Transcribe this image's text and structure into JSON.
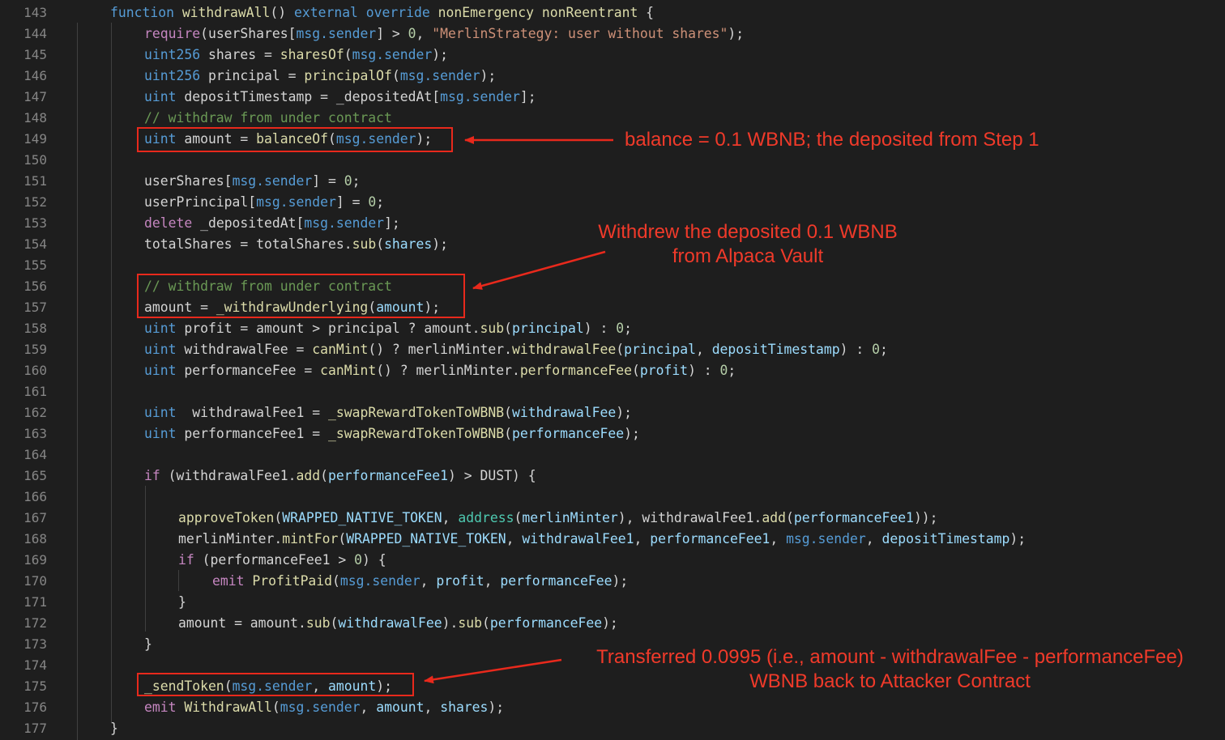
{
  "editor": {
    "lines": [
      {
        "num": "143",
        "indent": 0,
        "tokens": [
          [
            "function ",
            "kw"
          ],
          [
            "withdrawAll",
            "fn"
          ],
          [
            "() ",
            "pl"
          ],
          [
            "external override ",
            "kw"
          ],
          [
            "nonEmergency nonReentrant",
            "fn"
          ],
          [
            " {",
            "pl"
          ]
        ]
      },
      {
        "num": "144",
        "indent": 1,
        "tokens": [
          [
            "require",
            "ctl"
          ],
          [
            "(userShares[",
            "pl"
          ],
          [
            "msg.sender",
            "msg"
          ],
          [
            "] > ",
            "pl"
          ],
          [
            "0",
            "num"
          ],
          [
            ", ",
            "pl"
          ],
          [
            "\"MerlinStrategy: user without shares\"",
            "str"
          ],
          [
            ");",
            "pl"
          ]
        ]
      },
      {
        "num": "145",
        "indent": 1,
        "tokens": [
          [
            "uint256",
            "kw"
          ],
          [
            " shares = ",
            "pl"
          ],
          [
            "sharesOf",
            "fn"
          ],
          [
            "(",
            "pl"
          ],
          [
            "msg.sender",
            "msg"
          ],
          [
            ");",
            "pl"
          ]
        ]
      },
      {
        "num": "146",
        "indent": 1,
        "tokens": [
          [
            "uint256",
            "kw"
          ],
          [
            " principal = ",
            "pl"
          ],
          [
            "principalOf",
            "fn"
          ],
          [
            "(",
            "pl"
          ],
          [
            "msg.sender",
            "msg"
          ],
          [
            ");",
            "pl"
          ]
        ]
      },
      {
        "num": "147",
        "indent": 1,
        "tokens": [
          [
            "uint",
            "kw"
          ],
          [
            " depositTimestamp = _depositedAt[",
            "pl"
          ],
          [
            "msg.sender",
            "msg"
          ],
          [
            "];",
            "pl"
          ]
        ]
      },
      {
        "num": "148",
        "indent": 1,
        "tokens": [
          [
            "// withdraw from under contract",
            "cmt"
          ]
        ]
      },
      {
        "num": "149",
        "indent": 1,
        "tokens": [
          [
            "uint",
            "kw"
          ],
          [
            " amount = ",
            "pl"
          ],
          [
            "balanceOf",
            "fn"
          ],
          [
            "(",
            "pl"
          ],
          [
            "msg.sender",
            "msg"
          ],
          [
            ");",
            "pl"
          ]
        ]
      },
      {
        "num": "150",
        "indent": 1,
        "tokens": []
      },
      {
        "num": "151",
        "indent": 1,
        "tokens": [
          [
            "userShares[",
            "pl"
          ],
          [
            "msg.sender",
            "msg"
          ],
          [
            "] = ",
            "pl"
          ],
          [
            "0",
            "num"
          ],
          [
            ";",
            "pl"
          ]
        ]
      },
      {
        "num": "152",
        "indent": 1,
        "tokens": [
          [
            "userPrincipal[",
            "pl"
          ],
          [
            "msg.sender",
            "msg"
          ],
          [
            "] = ",
            "pl"
          ],
          [
            "0",
            "num"
          ],
          [
            ";",
            "pl"
          ]
        ]
      },
      {
        "num": "153",
        "indent": 1,
        "tokens": [
          [
            "delete",
            "ctl"
          ],
          [
            " _depositedAt[",
            "pl"
          ],
          [
            "msg.sender",
            "msg"
          ],
          [
            "];",
            "pl"
          ]
        ]
      },
      {
        "num": "154",
        "indent": 1,
        "tokens": [
          [
            "totalShares = totalShares.",
            "pl"
          ],
          [
            "sub",
            "fn"
          ],
          [
            "(",
            "pl"
          ],
          [
            "shares",
            "var"
          ],
          [
            ");",
            "pl"
          ]
        ]
      },
      {
        "num": "155",
        "indent": 1,
        "tokens": []
      },
      {
        "num": "156",
        "indent": 1,
        "tokens": [
          [
            "// withdraw from under contract",
            "cmt"
          ]
        ]
      },
      {
        "num": "157",
        "indent": 1,
        "tokens": [
          [
            "amount = ",
            "pl"
          ],
          [
            "_withdrawUnderlying",
            "fn"
          ],
          [
            "(",
            "pl"
          ],
          [
            "amount",
            "var"
          ],
          [
            ");",
            "pl"
          ]
        ]
      },
      {
        "num": "158",
        "indent": 1,
        "tokens": [
          [
            "uint",
            "kw"
          ],
          [
            " profit = amount > principal ? amount.",
            "pl"
          ],
          [
            "sub",
            "fn"
          ],
          [
            "(",
            "pl"
          ],
          [
            "principal",
            "var"
          ],
          [
            ") : ",
            "pl"
          ],
          [
            "0",
            "num"
          ],
          [
            ";",
            "pl"
          ]
        ]
      },
      {
        "num": "159",
        "indent": 1,
        "tokens": [
          [
            "uint",
            "kw"
          ],
          [
            " withdrawalFee = ",
            "pl"
          ],
          [
            "canMint",
            "fn"
          ],
          [
            "() ? merlinMinter.",
            "pl"
          ],
          [
            "withdrawalFee",
            "fn"
          ],
          [
            "(",
            "pl"
          ],
          [
            "principal",
            "var"
          ],
          [
            ", ",
            "pl"
          ],
          [
            "depositTimestamp",
            "var"
          ],
          [
            ") : ",
            "pl"
          ],
          [
            "0",
            "num"
          ],
          [
            ";",
            "pl"
          ]
        ]
      },
      {
        "num": "160",
        "indent": 1,
        "tokens": [
          [
            "uint",
            "kw"
          ],
          [
            " performanceFee = ",
            "pl"
          ],
          [
            "canMint",
            "fn"
          ],
          [
            "() ? merlinMinter.",
            "pl"
          ],
          [
            "performanceFee",
            "fn"
          ],
          [
            "(",
            "pl"
          ],
          [
            "profit",
            "var"
          ],
          [
            ") : ",
            "pl"
          ],
          [
            "0",
            "num"
          ],
          [
            ";",
            "pl"
          ]
        ]
      },
      {
        "num": "161",
        "indent": 1,
        "tokens": []
      },
      {
        "num": "162",
        "indent": 1,
        "tokens": [
          [
            "uint",
            "kw"
          ],
          [
            "  withdrawalFee1 = ",
            "pl"
          ],
          [
            "_swapRewardTokenToWBNB",
            "fn"
          ],
          [
            "(",
            "pl"
          ],
          [
            "withdrawalFee",
            "var"
          ],
          [
            ");",
            "pl"
          ]
        ]
      },
      {
        "num": "163",
        "indent": 1,
        "tokens": [
          [
            "uint",
            "kw"
          ],
          [
            " performanceFee1 = ",
            "pl"
          ],
          [
            "_swapRewardTokenToWBNB",
            "fn"
          ],
          [
            "(",
            "pl"
          ],
          [
            "performanceFee",
            "var"
          ],
          [
            ");",
            "pl"
          ]
        ]
      },
      {
        "num": "164",
        "indent": 1,
        "tokens": []
      },
      {
        "num": "165",
        "indent": 1,
        "tokens": [
          [
            "if",
            "ctl"
          ],
          [
            " (withdrawalFee1.",
            "pl"
          ],
          [
            "add",
            "fn"
          ],
          [
            "(",
            "pl"
          ],
          [
            "performanceFee1",
            "var"
          ],
          [
            ") > DUST) {",
            "pl"
          ]
        ]
      },
      {
        "num": "166",
        "indent": 2,
        "tokens": []
      },
      {
        "num": "167",
        "indent": 2,
        "tokens": [
          [
            "approveToken",
            "fn"
          ],
          [
            "(",
            "pl"
          ],
          [
            "WRAPPED_NATIVE_TOKEN",
            "var"
          ],
          [
            ", ",
            "pl"
          ],
          [
            "address",
            "ty"
          ],
          [
            "(",
            "pl"
          ],
          [
            "merlinMinter",
            "var"
          ],
          [
            "), withdrawalFee1.",
            "pl"
          ],
          [
            "add",
            "fn"
          ],
          [
            "(",
            "pl"
          ],
          [
            "performanceFee1",
            "var"
          ],
          [
            "));",
            "pl"
          ]
        ]
      },
      {
        "num": "168",
        "indent": 2,
        "tokens": [
          [
            "merlinMinter.",
            "pl"
          ],
          [
            "mintFor",
            "fn"
          ],
          [
            "(",
            "pl"
          ],
          [
            "WRAPPED_NATIVE_TOKEN",
            "var"
          ],
          [
            ", ",
            "pl"
          ],
          [
            "withdrawalFee1",
            "var"
          ],
          [
            ", ",
            "pl"
          ],
          [
            "performanceFee1",
            "var"
          ],
          [
            ", ",
            "pl"
          ],
          [
            "msg.sender",
            "msg"
          ],
          [
            ", ",
            "pl"
          ],
          [
            "depositTimestamp",
            "var"
          ],
          [
            ");",
            "pl"
          ]
        ]
      },
      {
        "num": "169",
        "indent": 2,
        "tokens": [
          [
            "if",
            "ctl"
          ],
          [
            " (performanceFee1 > ",
            "pl"
          ],
          [
            "0",
            "num"
          ],
          [
            ") {",
            "pl"
          ]
        ]
      },
      {
        "num": "170",
        "indent": 3,
        "tokens": [
          [
            "emit",
            "ctl"
          ],
          [
            " ",
            "pl"
          ],
          [
            "ProfitPaid",
            "fn"
          ],
          [
            "(",
            "pl"
          ],
          [
            "msg.sender",
            "msg"
          ],
          [
            ", ",
            "pl"
          ],
          [
            "profit",
            "var"
          ],
          [
            ", ",
            "pl"
          ],
          [
            "performanceFee",
            "var"
          ],
          [
            ");",
            "pl"
          ]
        ]
      },
      {
        "num": "171",
        "indent": 2,
        "tokens": [
          [
            "}",
            "pl"
          ]
        ]
      },
      {
        "num": "172",
        "indent": 2,
        "tokens": [
          [
            "amount = amount.",
            "pl"
          ],
          [
            "sub",
            "fn"
          ],
          [
            "(",
            "pl"
          ],
          [
            "withdrawalFee",
            "var"
          ],
          [
            ").",
            "pl"
          ],
          [
            "sub",
            "fn"
          ],
          [
            "(",
            "pl"
          ],
          [
            "performanceFee",
            "var"
          ],
          [
            ");",
            "pl"
          ]
        ]
      },
      {
        "num": "173",
        "indent": 1,
        "tokens": [
          [
            "}",
            "pl"
          ]
        ]
      },
      {
        "num": "174",
        "indent": 1,
        "tokens": []
      },
      {
        "num": "175",
        "indent": 1,
        "tokens": [
          [
            "_sendToken",
            "fn"
          ],
          [
            "(",
            "pl"
          ],
          [
            "msg.sender",
            "msg"
          ],
          [
            ", ",
            "pl"
          ],
          [
            "amount",
            "var"
          ],
          [
            ");",
            "pl"
          ]
        ]
      },
      {
        "num": "176",
        "indent": 1,
        "tokens": [
          [
            "emit",
            "ctl"
          ],
          [
            " ",
            "pl"
          ],
          [
            "WithdrawAll",
            "fn"
          ],
          [
            "(",
            "pl"
          ],
          [
            "msg.sender",
            "msg"
          ],
          [
            ", ",
            "pl"
          ],
          [
            "amount",
            "var"
          ],
          [
            ", ",
            "pl"
          ],
          [
            "shares",
            "var"
          ],
          [
            ");",
            "pl"
          ]
        ]
      },
      {
        "num": "177",
        "indent": 0,
        "tokens": [
          [
            "}",
            "pl"
          ]
        ]
      }
    ]
  },
  "annotations": {
    "balance": "balance = 0.1 WBNB; the deposited from Step 1",
    "withdrew_line1": "Withdrew the deposited 0.1 WBNB",
    "withdrew_line2": "from Alpaca Vault",
    "transferred_line1": "Transferred 0.0995 (i.e., amount - withdrawalFee - performanceFee)",
    "transferred_line2": "WBNB back to Attacker Contract"
  },
  "colors": {
    "background": "#1e1e1e",
    "annotation_red": "#f03a2a",
    "box_red": "#e8291c"
  }
}
